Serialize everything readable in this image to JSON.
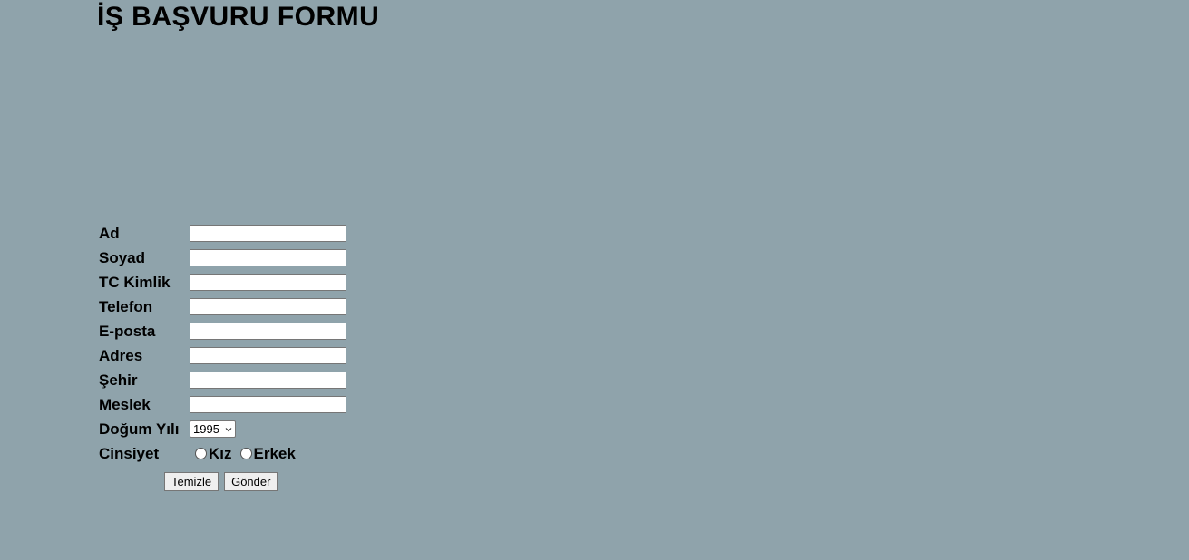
{
  "page": {
    "title": "İŞ BAŞVURU FORMU"
  },
  "form": {
    "fields": [
      {
        "label": "Ad",
        "value": ""
      },
      {
        "label": "Soyad",
        "value": ""
      },
      {
        "label": "TC Kimlik",
        "value": ""
      },
      {
        "label": "Telefon",
        "value": ""
      },
      {
        "label": "E-posta",
        "value": ""
      },
      {
        "label": "Adres",
        "value": ""
      },
      {
        "label": "Şehir",
        "value": ""
      },
      {
        "label": "Meslek",
        "value": ""
      }
    ],
    "birth_year": {
      "label": "Doğum Yılı",
      "selected": "1995"
    },
    "gender": {
      "label": "Cinsiyet",
      "options": [
        "Kız",
        "Erkek"
      ]
    },
    "buttons": {
      "reset_label": "Temizle",
      "submit_label": "Gönder"
    }
  },
  "colors": {
    "background": "#8fa3ab"
  }
}
